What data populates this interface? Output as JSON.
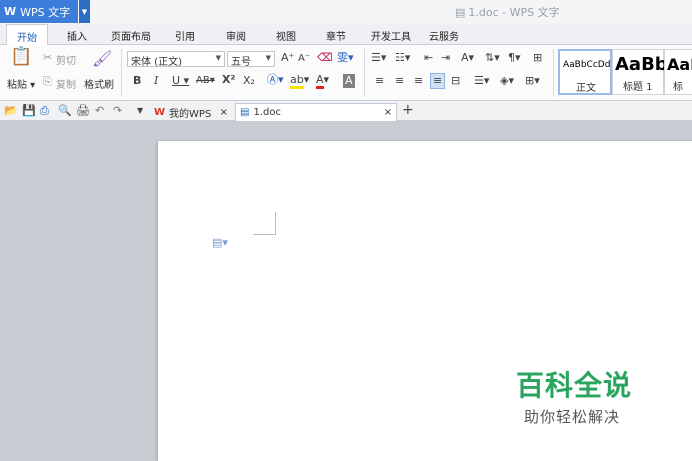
{
  "app": {
    "name": "WPS 文字",
    "doc_title": "1.doc - WPS 文字"
  },
  "menu": [
    {
      "label": "开始",
      "active": true
    },
    {
      "label": "插入"
    },
    {
      "label": "页面布局"
    },
    {
      "label": "引用"
    },
    {
      "label": "审阅"
    },
    {
      "label": "视图"
    },
    {
      "label": "章节"
    },
    {
      "label": "开发工具"
    },
    {
      "label": "云服务"
    }
  ],
  "ribbon": {
    "paste": "粘贴",
    "cut": "剪切",
    "copy": "复制",
    "format_painter": "格式刷",
    "font_name": "宋体 (正文)",
    "font_size": "五号",
    "styles": [
      {
        "preview": "AaBbCcDd",
        "label": "正文"
      },
      {
        "preview": "AaBb",
        "label": "标题 1"
      },
      {
        "preview": "AaB",
        "label": "标题"
      }
    ]
  },
  "tabs": [
    {
      "label": "我的WPS"
    },
    {
      "label": "1.doc"
    }
  ],
  "watermark": {
    "title": "百科全说",
    "subtitle": "助你轻松解决"
  }
}
